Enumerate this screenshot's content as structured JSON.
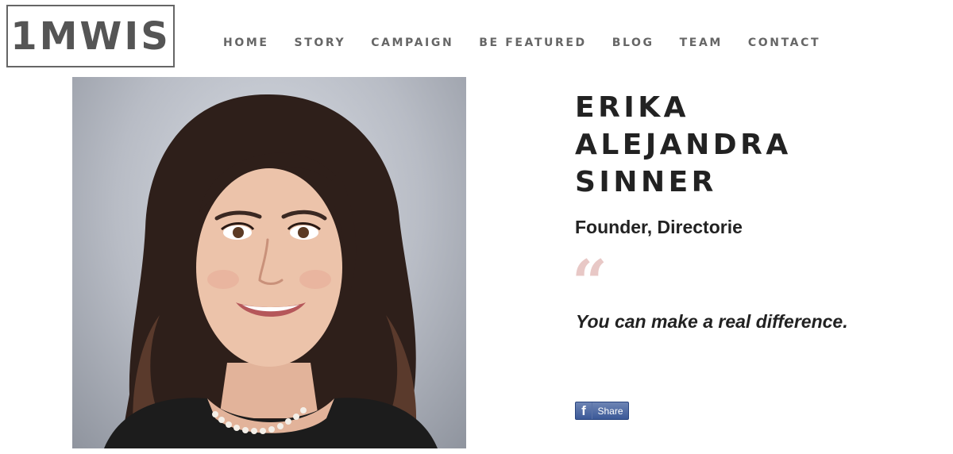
{
  "logo": {
    "text": "1MWIS"
  },
  "nav": {
    "items": [
      "HOME",
      "STORY",
      "CAMPAIGN",
      "BE FEATURED",
      "BLOG",
      "TEAM",
      "CONTACT"
    ]
  },
  "profile": {
    "name_lines": [
      "ERIKA",
      "ALEJANDRA",
      "SINNER"
    ],
    "role": "Founder, Directorie",
    "quote_mark": "“",
    "quote": "You can make a real difference."
  },
  "share": {
    "icon": "f",
    "label": "Share"
  },
  "colors": {
    "quote_mark": "#e8c8c6",
    "facebook": "#3b5998",
    "text": "#222222",
    "nav": "#666666"
  },
  "icons": {
    "facebook": "facebook-icon",
    "quote": "quote-icon"
  }
}
